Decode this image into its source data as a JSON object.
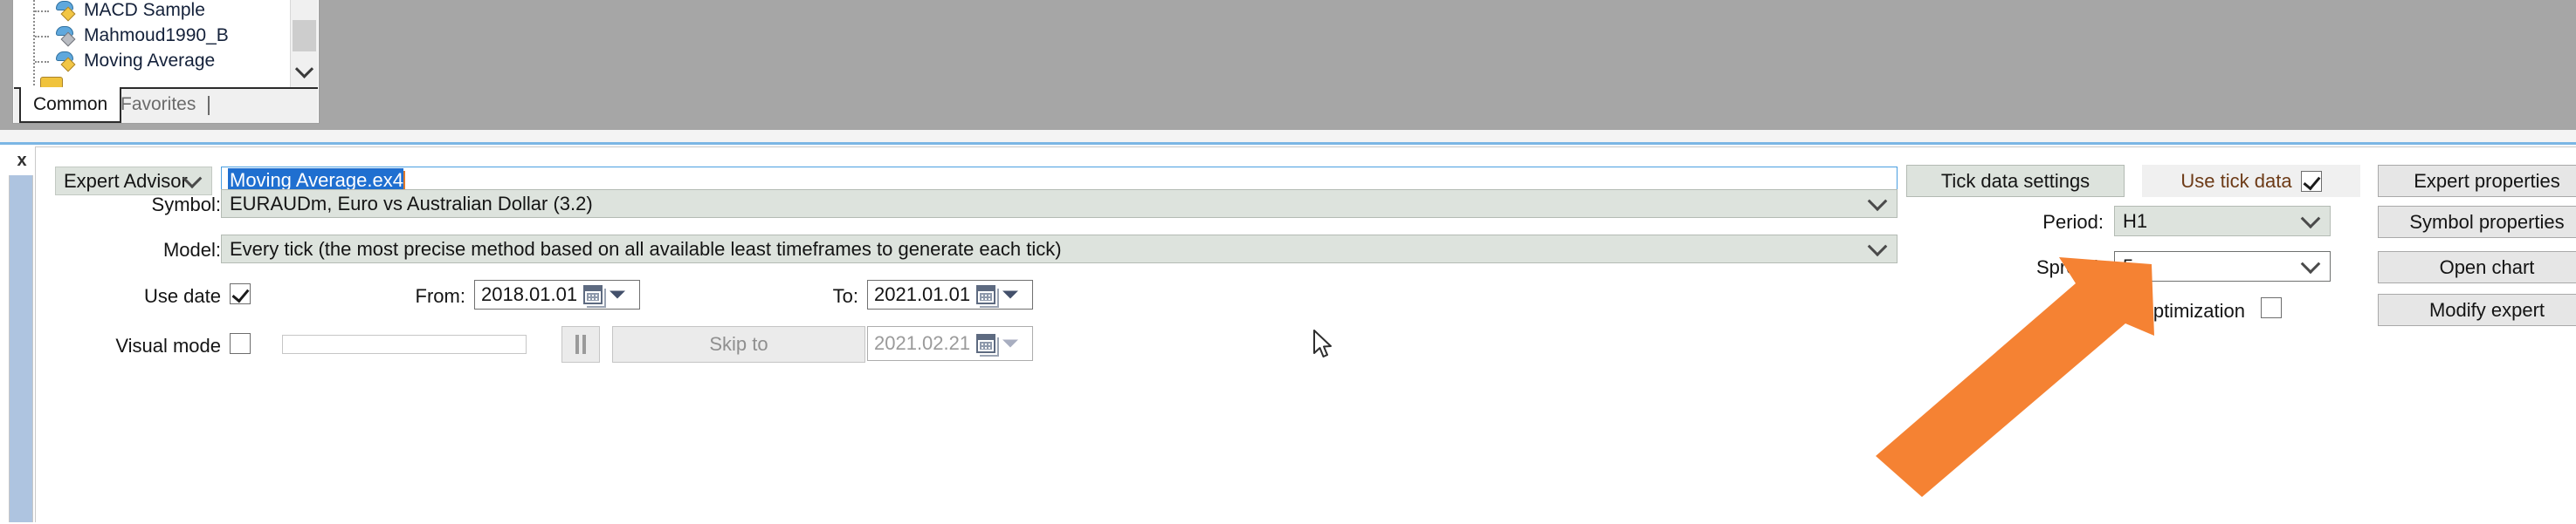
{
  "navigator": {
    "tree_items": [
      {
        "label": "MACD Sample",
        "icon": "expert-advisor-icon"
      },
      {
        "label": "Mahmoud1990_B",
        "icon": "expert-advisor-icon"
      },
      {
        "label": "Moving Average",
        "icon": "expert-advisor-icon"
      }
    ],
    "tabs": [
      {
        "label": "Common",
        "active": true
      },
      {
        "label": "Favorites",
        "active": false
      }
    ]
  },
  "tester": {
    "close_label": "x",
    "expert_type": "Expert Advisor",
    "expert_file": "Moving Average.ex4",
    "labels": {
      "symbol": "Symbol:",
      "model": "Model:",
      "use_date": "Use date",
      "from": "From:",
      "to": "To:",
      "visual_mode": "Visual mode",
      "period": "Period:",
      "spread": "Spread:",
      "optimization": "Optimization",
      "use_tick_data": "Use tick data"
    },
    "symbol_value": "EURAUDm, Euro vs Australian Dollar (3.2)",
    "model_value": "Every tick (the most precise method based on all available least timeframes to generate each tick)",
    "date_from": "2018.01.01",
    "date_to": "2021.01.01",
    "skip_to_date": "2021.02.21",
    "skip_to_label": "Skip to",
    "period_value": "H1",
    "spread_value": "5",
    "checkboxes": {
      "use_date": true,
      "visual_mode": false,
      "use_tick_data": true,
      "optimization": false
    },
    "buttons": {
      "tick_data_settings": "Tick data settings",
      "expert_properties": "Expert properties",
      "symbol_properties": "Symbol properties",
      "open_chart": "Open chart",
      "modify_expert": "Modify expert"
    }
  },
  "annotation": {
    "arrow_color": "#F58233",
    "points_at": "spread-combo"
  },
  "colors": {
    "selection_blue": "#1F6FD0",
    "accent_orange": "#F58233",
    "tick_data_text": "#6D3B17",
    "top_panel_gray": "#A6A6A6",
    "control_green_gray": "#DDE3DD"
  }
}
